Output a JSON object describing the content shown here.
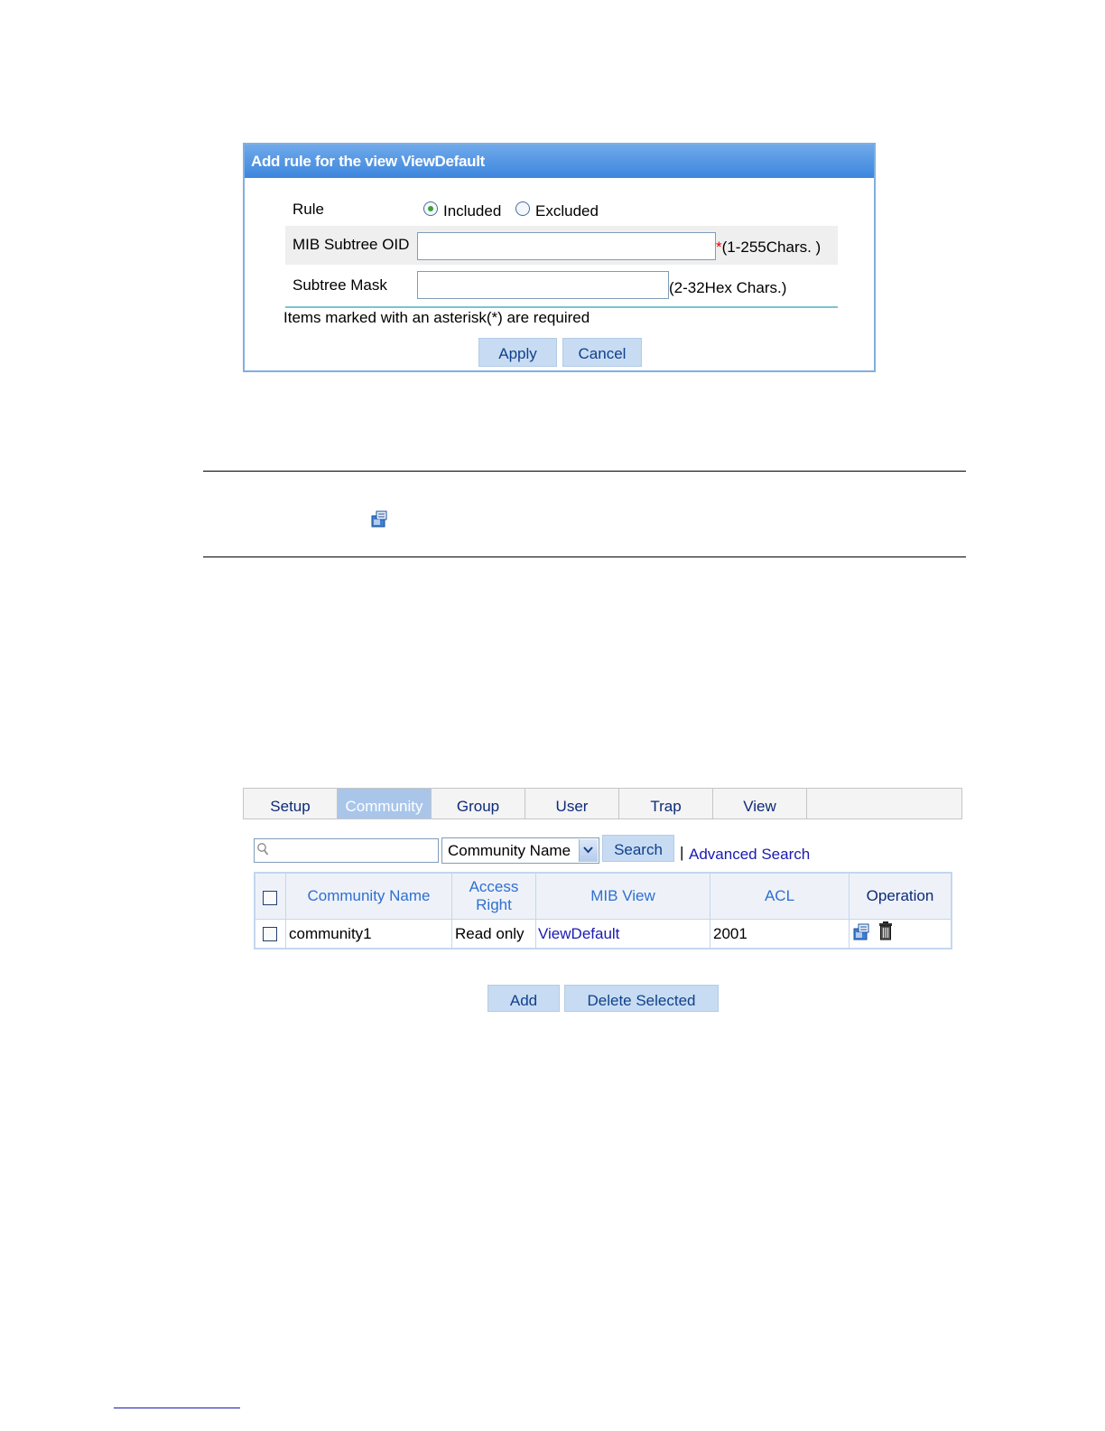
{
  "dialog": {
    "title": "Add rule for the view ViewDefault",
    "rule_label": "Rule",
    "rule_options": [
      "Included",
      "Excluded"
    ],
    "rule_selected": "Included",
    "oid_label": "MIB Subtree OID",
    "oid_value": "",
    "oid_required": "*",
    "oid_hint": "(1-255Chars. )",
    "mask_label": "Subtree Mask",
    "mask_value": "",
    "mask_hint": "(2-32Hex Chars.)",
    "required_note": "Items marked with an asterisk(*) are required",
    "apply_label": "Apply",
    "cancel_label": "Cancel"
  },
  "note": {
    "icon": "edit-icon"
  },
  "snmp": {
    "tabs": [
      "Setup",
      "Community",
      "Group",
      "User",
      "Trap",
      "View"
    ],
    "active_tab": "Community",
    "search": {
      "value": "",
      "field": "Community Name",
      "button": "Search",
      "separator": "|",
      "advanced": "Advanced Search"
    },
    "table": {
      "headers": [
        "Community Name",
        "Access Right",
        "MIB View",
        "ACL",
        "Operation"
      ],
      "header_access_lines": [
        "Access",
        "Right"
      ],
      "rows": [
        {
          "community_name": "community1",
          "access_right": "Read only",
          "mib_view": "ViewDefault",
          "acl": "2001",
          "operation_icons": [
            "edit-icon",
            "delete-icon"
          ]
        }
      ]
    },
    "add_label": "Add",
    "delete_selected_label": "Delete Selected"
  },
  "colors": {
    "title_bar": "#3d86de",
    "active_tab": "#a9c6ea",
    "button": "#c7dcf3",
    "link": "#1a1ab4",
    "required": "#e00000"
  }
}
